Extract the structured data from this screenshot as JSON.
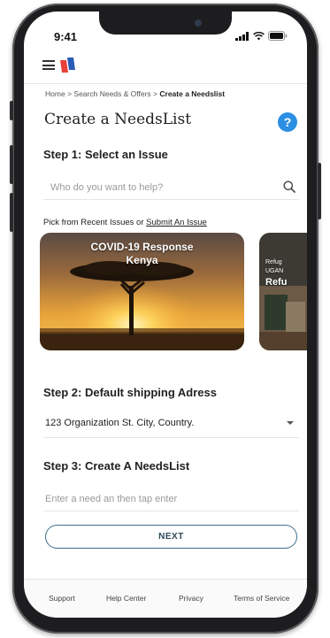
{
  "status_bar": {
    "time": "9:41"
  },
  "breadcrumb": {
    "home": "Home",
    "separator": ">",
    "search": "Search Needs & Offers",
    "current": "Create a Needslist"
  },
  "page": {
    "title": "Create a NeedsList",
    "help_label": "?"
  },
  "step1": {
    "label": "Step 1: Select an Issue",
    "search_placeholder": "Who do you want to help?",
    "recent_prefix": "Pick from Recent Issues or",
    "submit_link": "Submit An Issue",
    "cards": [
      {
        "title": "COVID-19 Response",
        "subtitle": "Kenya"
      },
      {
        "title_line1": "Refug",
        "title_line2": "UGAN",
        "title_line3": "Refu"
      }
    ]
  },
  "step2": {
    "label": "Step 2: Default shipping Adress",
    "address_value": "123 Organization St. City, Country."
  },
  "step3": {
    "label": "Step 3: Create A NeedsList",
    "need_placeholder": "Enter a need an then tap enter"
  },
  "actions": {
    "next_label": "NEXT"
  },
  "footer": {
    "links": [
      "Support",
      "Help Center",
      "Privacy",
      "Terms of Service"
    ]
  },
  "colors": {
    "accent": "#2b8fe3",
    "button_border": "#3d6f8a",
    "logo_red": "#e8423a",
    "logo_blue": "#2a5bb8"
  }
}
